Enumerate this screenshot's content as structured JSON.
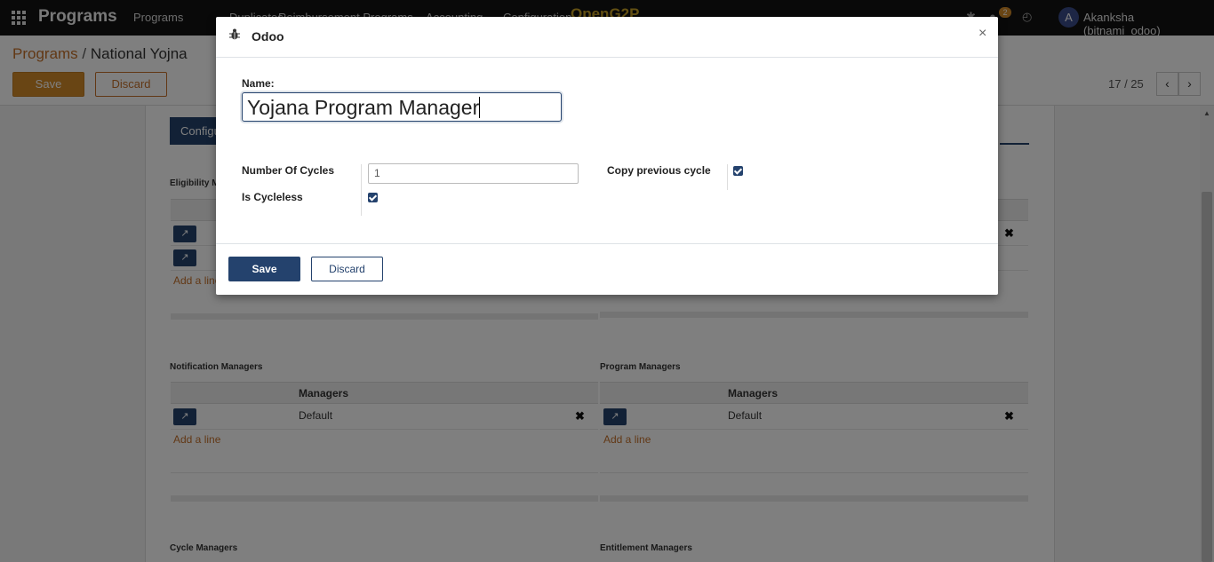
{
  "navbar": {
    "brand": "Programs",
    "menu": [
      "Programs",
      "Duplicates",
      "Reimbursement Programs",
      "Accounting",
      "Configuration"
    ],
    "logo": "OpenG2P",
    "notification_count": "2",
    "avatar_letter": "A",
    "user": "Akanksha (bitnami_odoo)"
  },
  "control_panel": {
    "breadcrumb_root": "Programs",
    "breadcrumb_sep": "/",
    "breadcrumb_current": "National Yojna",
    "save_label": "Save",
    "discard_label": "Discard",
    "pager": "17 / 25",
    "prev_glyph": "‹",
    "next_glyph": "›"
  },
  "form": {
    "tab_label": "Configu",
    "eligibility_title": "Eligibility M",
    "add_line": "Add a line",
    "notification_title": "Notification Managers",
    "program_title": "Program Managers",
    "cycle_title": "Cycle Managers",
    "entitlement_title": "Entitlement Managers",
    "column_managers": "Managers",
    "default_row": "Default",
    "delete_glyph": "✖",
    "open_glyph": "↗"
  },
  "modal": {
    "title": "Odoo",
    "close_glyph": "×",
    "name_label": "Name:",
    "name_value": "Yojana Program Manager",
    "cycles_label": "Number Of Cycles",
    "cycles_value": "1",
    "cycleless_label": "Is Cycleless",
    "cycleless_checked": true,
    "copy_label": "Copy previous cycle",
    "copy_checked": true,
    "save_label": "Save",
    "discard_label": "Discard"
  },
  "colors": {
    "primary": "#24426d",
    "accent": "#d38b29",
    "link": "#c4702a",
    "navbar": "#121212"
  },
  "icons": [
    "apps-grid-icon",
    "bug-icon",
    "chat-icon",
    "clock-icon",
    "external-link-icon",
    "delete-icon",
    "chevron-left-icon",
    "chevron-right-icon",
    "close-icon"
  ]
}
